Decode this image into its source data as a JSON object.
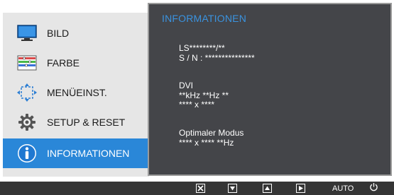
{
  "menu": {
    "items": [
      {
        "label": "BILD",
        "icon": "monitor-icon"
      },
      {
        "label": "FARBE",
        "icon": "color-bars-icon"
      },
      {
        "label": "MENÜEINST.",
        "icon": "menu-settings-icon"
      },
      {
        "label": "SETUP & RESET",
        "icon": "gear-icon"
      },
      {
        "label": "INFORMATIONEN",
        "icon": "info-icon",
        "selected": true
      }
    ]
  },
  "info": {
    "title": "INFORMATIONEN",
    "model": "LS********/**",
    "serial": "S / N : ***************",
    "input_source": "DVI",
    "frequency": "**kHz **Hz **",
    "resolution": "**** x ****",
    "optimal_mode_label": "Optimaler Modus",
    "optimal_mode_value": "**** x **** **Hz"
  },
  "buttons": {
    "auto_label": "AUTO",
    "icons": [
      "close-icon",
      "down-arrow-icon",
      "up-arrow-icon",
      "enter-icon",
      "auto-button",
      "power-icon"
    ]
  },
  "colors": {
    "accent": "#2a87d8",
    "title": "#3a93e0",
    "panel": "#444549",
    "bar": "#353535"
  }
}
